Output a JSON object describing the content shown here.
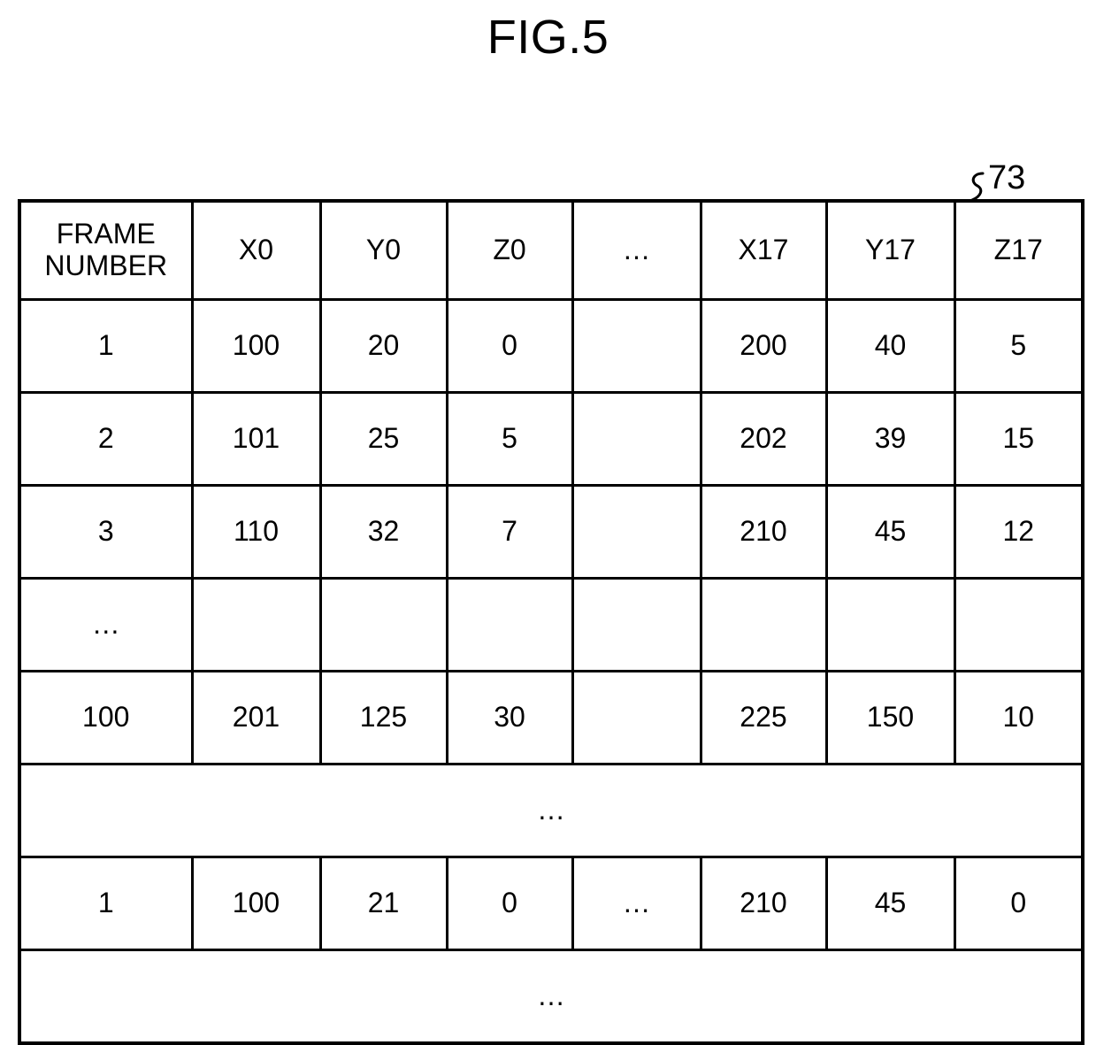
{
  "figure": {
    "title": "FIG.5",
    "reference_numeral": "73"
  },
  "table": {
    "headers": [
      {
        "line1": "FRAME",
        "line2": "NUMBER"
      },
      {
        "line1": "X0"
      },
      {
        "line1": "Y0"
      },
      {
        "line1": "Z0"
      },
      {
        "line1": "…"
      },
      {
        "line1": "X17"
      },
      {
        "line1": "Y17"
      },
      {
        "line1": "Z17"
      }
    ],
    "rows": [
      {
        "type": "data",
        "cells": [
          "1",
          "100",
          "20",
          "0",
          "",
          "200",
          "40",
          "5"
        ]
      },
      {
        "type": "data",
        "cells": [
          "2",
          "101",
          "25",
          "5",
          "",
          "202",
          "39",
          "15"
        ]
      },
      {
        "type": "data",
        "cells": [
          "3",
          "110",
          "32",
          "7",
          "",
          "210",
          "45",
          "12"
        ]
      },
      {
        "type": "data",
        "cells": [
          "…",
          "",
          "",
          "",
          "",
          "",
          "",
          ""
        ]
      },
      {
        "type": "data",
        "cells": [
          "100",
          "201",
          "125",
          "30",
          "",
          "225",
          "150",
          "10"
        ]
      },
      {
        "type": "merged",
        "text": "…"
      },
      {
        "type": "data",
        "cells": [
          "1",
          "100",
          "21",
          "0",
          "…",
          "210",
          "45",
          "0"
        ]
      },
      {
        "type": "merged",
        "text": "…"
      }
    ]
  },
  "colors": {
    "line": "#000000",
    "background": "#ffffff",
    "text": "#000000"
  }
}
